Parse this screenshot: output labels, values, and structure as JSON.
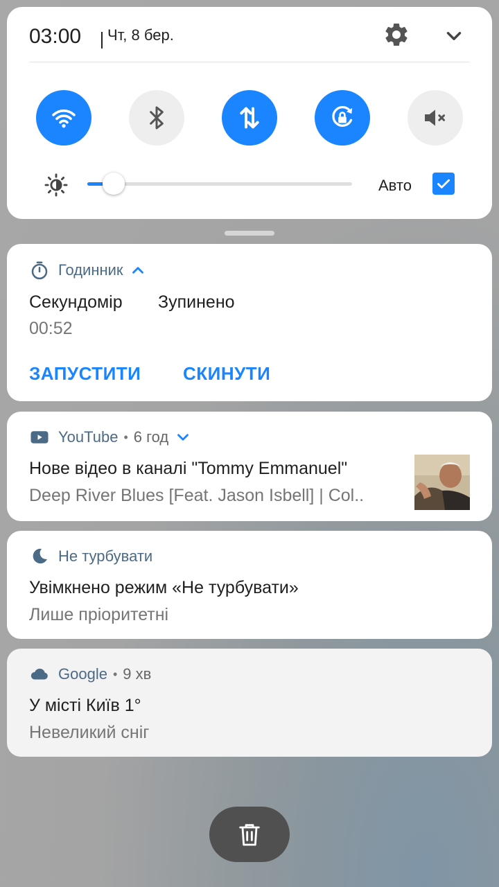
{
  "status": {
    "time": "03:00",
    "date": "Чт, 8 бер."
  },
  "quick_settings": {
    "tiles": [
      {
        "name": "wifi",
        "state": "on",
        "icon": "wifi-icon"
      },
      {
        "name": "bluetooth",
        "state": "off",
        "icon": "bluetooth-icon"
      },
      {
        "name": "mobile-data",
        "state": "on",
        "icon": "data-transfer-icon"
      },
      {
        "name": "auto-rotate",
        "state": "on",
        "icon": "rotation-lock-icon"
      },
      {
        "name": "sound",
        "state": "off",
        "icon": "mute-icon"
      }
    ],
    "brightness": {
      "level": 0.1,
      "auto_label": "Авто",
      "auto_checked": true
    }
  },
  "colors": {
    "accent": "#1a85ff",
    "app_name": "#4a6a86"
  },
  "notifications": {
    "clock": {
      "app": "Годинник",
      "title_left": "Секундомір",
      "title_right": "Зупинено",
      "elapsed": "00:52",
      "action_start": "ЗАПУСТИТИ",
      "action_reset": "СКИНУТИ"
    },
    "youtube": {
      "app": "YouTube",
      "age": "6 год",
      "title": "Нове відео в каналі \"Tommy Emmanuel\"",
      "text": "Deep River Blues [Feat. Jason Isbell] | Col.."
    },
    "dnd": {
      "app": "Не турбувати",
      "title": "Увімкнено режим «Не турбувати»",
      "text": "Лише пріоритетні"
    },
    "google": {
      "app": "Google",
      "age": "9 хв",
      "title": "У місті Київ 1°",
      "text": "Невеликий сніг"
    }
  },
  "dot_separator": "•"
}
